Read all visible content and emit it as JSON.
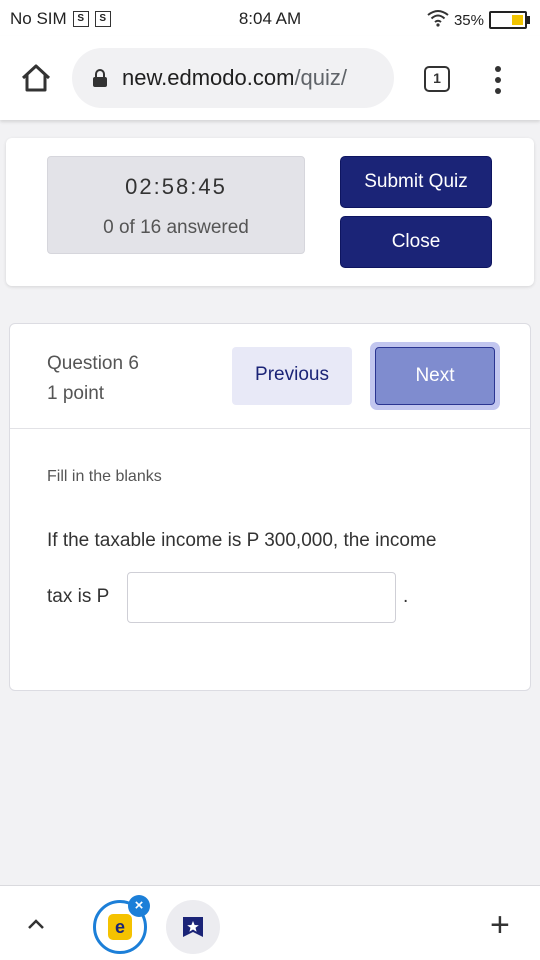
{
  "status_bar": {
    "carrier": "No SIM",
    "time": "8:04 AM",
    "battery": "35%",
    "sim_icon_glyph": "S",
    "icons": [
      "sim-card-icon",
      "sim-card-icon",
      "wifi-icon",
      "battery-icon"
    ]
  },
  "browser": {
    "url_domain": "new.edmodo.com",
    "url_path": "/quiz/",
    "tab_count": "1",
    "icons": [
      "home-icon",
      "lock-icon",
      "tabs-icon",
      "kebab-menu-icon"
    ]
  },
  "quiz_header": {
    "timer": "02:58:45",
    "answered": "0 of 16 answered",
    "submit_label": "Submit Quiz",
    "close_label": "Close"
  },
  "question": {
    "number_label": "Question 6",
    "points_label": "1 point",
    "previous_label": "Previous",
    "next_label": "Next",
    "type_label": "Fill in the blanks",
    "text_line1": "If the taxable income is P 300,000, the income",
    "text_line2": "tax is P",
    "answer_value": "",
    "trailing_text": "."
  },
  "bottom_bar": {
    "edmodo_glyph": "e",
    "badge_glyph": "×",
    "plus_glyph": "+",
    "icons": [
      "chevron-up-icon",
      "edmodo-app-icon",
      "close-badge-icon",
      "bookmark-star-icon",
      "plus-icon"
    ]
  },
  "colors": {
    "primary_dark": "#1b2477",
    "next_button": "#7f8ccf",
    "accent_blue": "#1c7fd8",
    "edmodo_yellow": "#f5c200"
  }
}
